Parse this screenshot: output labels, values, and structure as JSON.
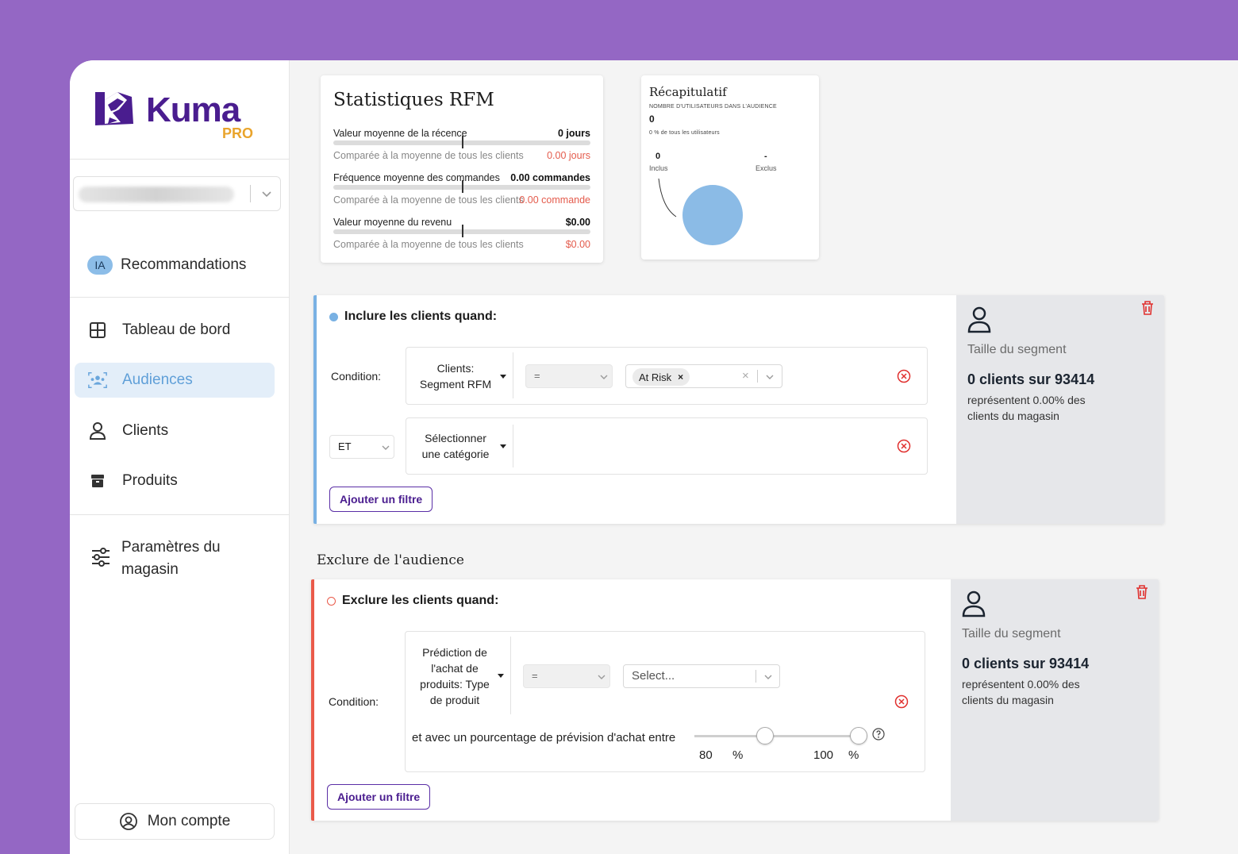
{
  "brand": {
    "name": "Kuma",
    "tier": "PRO",
    "primary": "#4a1d8f",
    "accent": "#e9a42c"
  },
  "sidebar": {
    "recommendations": {
      "badge": "IA",
      "label": "Recommandations"
    },
    "items": [
      {
        "label": "Tableau de bord",
        "icon": "grid-icon"
      },
      {
        "label": "Audiences",
        "icon": "audience-icon",
        "active": true
      },
      {
        "label": "Clients",
        "icon": "person-icon"
      },
      {
        "label": "Produits",
        "icon": "box-icon"
      }
    ],
    "settings": {
      "label": "Paramètres du magasin",
      "icon": "sliders-icon"
    },
    "account": {
      "label": "Mon compte",
      "icon": "user-circle-icon"
    }
  },
  "rfm": {
    "title": "Statistiques RFM",
    "rows": [
      {
        "label": "Valeur moyenne de la récence",
        "value": "0 jours",
        "compare_label": "Comparée à la moyenne de tous les clients",
        "compare_value": "0.00 jours"
      },
      {
        "label": "Fréquence moyenne des commandes",
        "value": "0.00 commandes",
        "compare_label": "Comparée à la moyenne de tous les clients",
        "compare_value": "0.00 commande"
      },
      {
        "label": "Valeur moyenne du revenu",
        "value": "$0.00",
        "compare_label": "Comparée à la moyenne de tous les clients",
        "compare_value": "$0.00"
      }
    ]
  },
  "recap": {
    "title": "Récapitulatif",
    "users_label": "NOMBRE D'UTILISATEURS DANS L'AUDIENCE",
    "users_value": "0",
    "percent_label": "0 % de tous les utilisateurs",
    "included_value": "0",
    "included_label": "Inclus",
    "excluded_value": "-",
    "excluded_label": "Exclus",
    "pie_color": "#8bbbe6"
  },
  "include": {
    "header": "Inclure les clients quand:",
    "condition_label": "Condition:",
    "field": "Clients: Segment RFM",
    "operator": "=",
    "chip": "At Risk",
    "and_operator": "ET",
    "category_placeholder": "Sélectionner une catégorie",
    "add_filter": "Ajouter un filtre",
    "summary": {
      "title": "Taille du segment",
      "count": "0 clients sur 93414",
      "description": "représentent 0.00% des clients du magasin"
    }
  },
  "exclude": {
    "section_title": "Exclure de l'audience",
    "header": "Exclure les clients quand:",
    "condition_label": "Condition:",
    "field": "Prédiction de l'achat de produits: Type de produit",
    "operator": "=",
    "value_placeholder": "Select...",
    "range_text": "et avec un pourcentage de prévision d'achat entre",
    "range_min": "80",
    "range_max": "100",
    "percent_unit": "%",
    "add_filter": "Ajouter un filtre",
    "summary": {
      "title": "Taille du segment",
      "count": "0 clients sur 93414",
      "description": "représentent 0.00% des clients du magasin"
    }
  }
}
